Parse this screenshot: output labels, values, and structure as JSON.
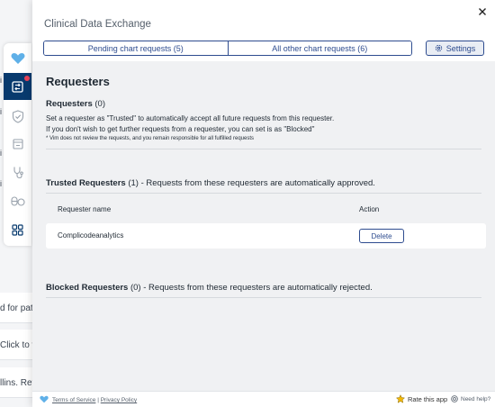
{
  "background": {
    "rows": [
      "d for patie",
      "Click to vi",
      "llins. Revi"
    ],
    "rail_letters": [
      "i",
      "i",
      "i",
      "i"
    ]
  },
  "panel": {
    "title": "Clinical Data Exchange",
    "tabs": [
      "Pending chart requests (5)",
      "All other chart requests (6)"
    ],
    "settings_label": "Settings"
  },
  "requesters": {
    "heading": "Requesters",
    "section_label": "Requesters",
    "section_count": "(0)",
    "desc_line1": "Set a requester as \"Trusted\" to automatically accept all future requests from this requester.",
    "desc_line2": "If you don't wish to get further requests from a requester, you can set is as \"Blocked\"",
    "note": "* Vim does not review the requests, and you remain responsible for all fulfilled requests"
  },
  "trusted": {
    "label": "Trusted Requesters",
    "count": "(1)",
    "desc": " - Requests from these requesters are automatically approved.",
    "columns": [
      "Requester name",
      "Action"
    ],
    "rows": [
      {
        "name": "Complicodeanalytics",
        "action": "Delete"
      }
    ]
  },
  "blocked": {
    "label": "Blocked Requesters",
    "count": "(0)",
    "desc": " - Requests from these requesters are automatically rejected."
  },
  "footer": {
    "terms": "Terms of Service",
    "separator": " | ",
    "privacy": "Privacy Policy",
    "rate": "Rate this app",
    "help": "Need help?"
  },
  "colors": {
    "brand_blue": "#2e4c8f",
    "rail_active": "#083a6e",
    "heart": "#5fb0e8",
    "notification_dot": "#e8435a",
    "star": "#f2b705"
  }
}
